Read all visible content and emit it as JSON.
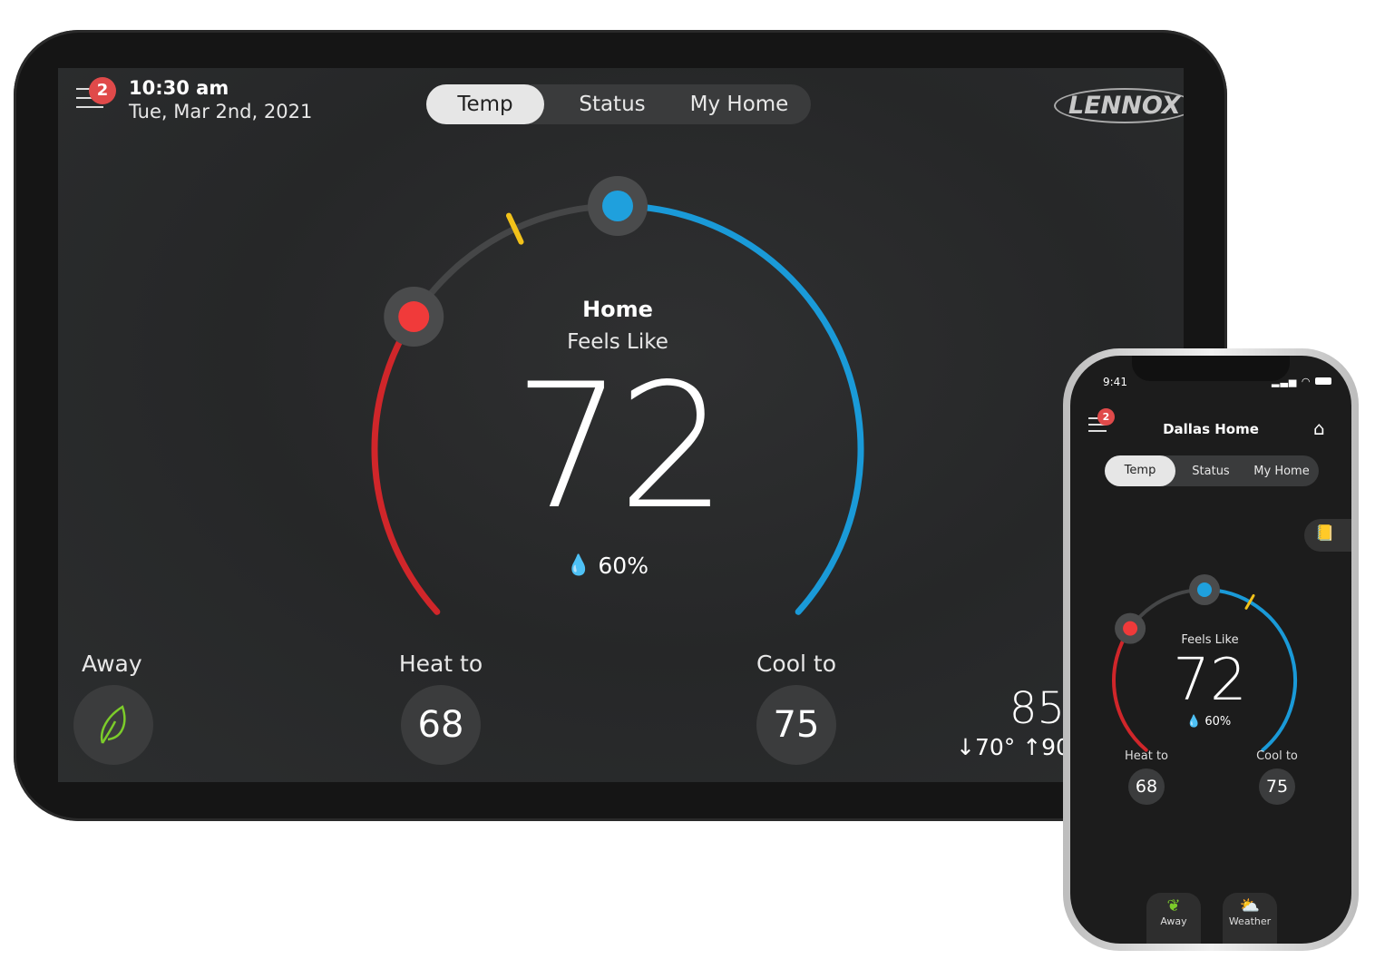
{
  "tablet": {
    "notification_count": "2",
    "time": "10:30 am",
    "date": "Tue, Mar 2nd, 2021",
    "tabs": [
      {
        "label": "Temp",
        "active": true
      },
      {
        "label": "Status",
        "active": false
      },
      {
        "label": "My Home",
        "active": false
      }
    ],
    "brand": "LENNOX",
    "mode_title": "Home",
    "feels_like_label": "Feels Like",
    "feels_like_temp": "72",
    "humidity": "60%",
    "away_label": "Away",
    "heat_label": "Heat to",
    "heat_setpoint": "68",
    "cool_label": "Cool to",
    "cool_setpoint": "75",
    "outdoor_temp": "85",
    "outdoor_low_high": "↓70° ↑90"
  },
  "phone": {
    "status_time": "9:41",
    "notification_count": "2",
    "title": "Dallas Home",
    "tabs": [
      {
        "label": "Temp",
        "active": true
      },
      {
        "label": "Status",
        "active": false
      },
      {
        "label": "My Home",
        "active": false
      }
    ],
    "feels_like_label": "Feels Like",
    "feels_like_temp": "72",
    "humidity": "60%",
    "heat_label": "Heat to",
    "heat_setpoint": "68",
    "cool_label": "Cool to",
    "cool_setpoint": "75",
    "bottom_buttons": [
      {
        "label": "Away",
        "icon": "leaf-icon"
      },
      {
        "label": "Weather",
        "icon": "weather-icon"
      }
    ]
  },
  "colors": {
    "heat": "#d0262a",
    "cool": "#1a9ad8",
    "knob_heat": "#f03a3a",
    "knob_cool": "#1fa0dd",
    "indicator": "#f2c21a",
    "leaf": "#7ccc2a",
    "badge": "#e04a4a"
  }
}
